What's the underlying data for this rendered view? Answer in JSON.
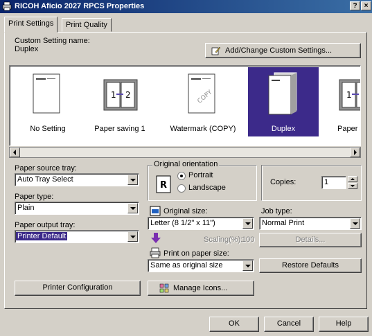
{
  "window": {
    "title": "RICOH Aficio 2027 RPCS Properties",
    "help_glyph": "?",
    "close_glyph": "×"
  },
  "tabs": [
    {
      "label": "Print Settings"
    },
    {
      "label": "Print Quality"
    }
  ],
  "custom_settings": {
    "label": "Custom Setting name:",
    "current": "Duplex",
    "add_change_button": "Add/Change Custom Settings..."
  },
  "presets": [
    {
      "label": "No Setting"
    },
    {
      "label": "Paper saving 1"
    },
    {
      "label": "Watermark (COPY)"
    },
    {
      "label": "Duplex"
    },
    {
      "label": "Paper savi"
    }
  ],
  "selected_preset": "Duplex",
  "paper_source": {
    "label": "Paper source tray:",
    "value": "Auto Tray Select"
  },
  "paper_type": {
    "label": "Paper type:",
    "value": "Plain"
  },
  "paper_output": {
    "label": "Paper output tray:",
    "value": "Printer Default"
  },
  "orientation": {
    "group_label": "Original orientation",
    "portrait": "Portrait",
    "landscape": "Landscape",
    "selected": "Portrait"
  },
  "copies": {
    "label": "Copies:",
    "value": "1"
  },
  "original_size": {
    "label": "Original size:",
    "value": "Letter (8 1/2\" x 11\")"
  },
  "scaling": {
    "label": "Scaling(%):",
    "value": "100"
  },
  "print_paper_size": {
    "label": "Print on paper size:",
    "value": "Same as original size"
  },
  "job_type": {
    "label": "Job type:",
    "value": "Normal Print",
    "details_button": "Details..."
  },
  "restore_defaults_button": "Restore Defaults",
  "printer_configuration_button": "Printer Configuration",
  "manage_icons_button": "Manage Icons...",
  "dialog_buttons": {
    "ok": "OK",
    "cancel": "Cancel",
    "help": "Help"
  },
  "colors": {
    "title_bar": "#0a246a",
    "selection": "#3c2a8a",
    "arrow_accent": "#7a2fb0"
  }
}
